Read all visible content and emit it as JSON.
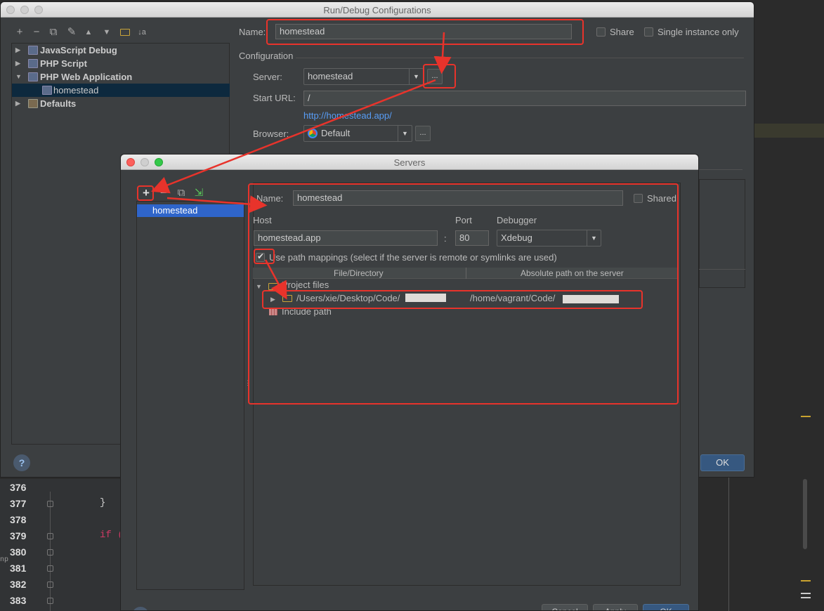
{
  "editor": {
    "line_numbers": [
      "376",
      "377",
      "378",
      "379",
      "380",
      "381",
      "382",
      "383"
    ],
    "code_brace": "}",
    "code_if": "if (",
    "gutter_mark": "np"
  },
  "run_debug": {
    "title": "Run/Debug Configurations",
    "tree": [
      {
        "label": "JavaScript Debug",
        "expanded": false
      },
      {
        "label": "PHP Script",
        "expanded": false
      },
      {
        "label": "PHP Web Application",
        "expanded": true
      },
      {
        "label": "homestead",
        "selected": true
      },
      {
        "label": "Defaults",
        "expanded": false
      }
    ],
    "name_label": "Name:",
    "name_value": "homestead",
    "share_label": "Share",
    "single_instance_label": "Single instance only",
    "configuration_label": "Configuration",
    "server_label": "Server:",
    "server_value": "homestead",
    "ellipsis": "...",
    "start_url_label": "Start URL:",
    "start_url_value": "/",
    "url_link": "http://homestead.app/",
    "browser_label": "Browser:",
    "browser_value": "Default",
    "ok_label": "OK",
    "help_label": "?"
  },
  "servers": {
    "title": "Servers",
    "add_icon": "+",
    "remove_icon": "−",
    "list_items": [
      "homestead"
    ],
    "name_label": "Name:",
    "name_value": "homestead",
    "shared_label": "Shared",
    "host_label": "Host",
    "host_value": "homestead.app",
    "colon": ":",
    "port_label": "Port",
    "port_value": "80",
    "debugger_label": "Debugger",
    "debugger_value": "Xdebug",
    "path_mappings_label": "Use path mappings (select if the server is remote or symlinks are used)",
    "col_file": "File/Directory",
    "col_abs": "Absolute path on the server",
    "project_files": "Project files",
    "mapping_local": "/Users/xie/Desktop/Code/",
    "mapping_remote": "/home/vagrant/Code/",
    "include_path": "Include path",
    "help_label": "?",
    "bottom_buttons": [
      "Cancel",
      "Apply",
      "OK"
    ]
  },
  "colors": {
    "annotation_red": "#e8332b",
    "selection_blue": "#2f65ca",
    "link_blue": "#589df6"
  }
}
